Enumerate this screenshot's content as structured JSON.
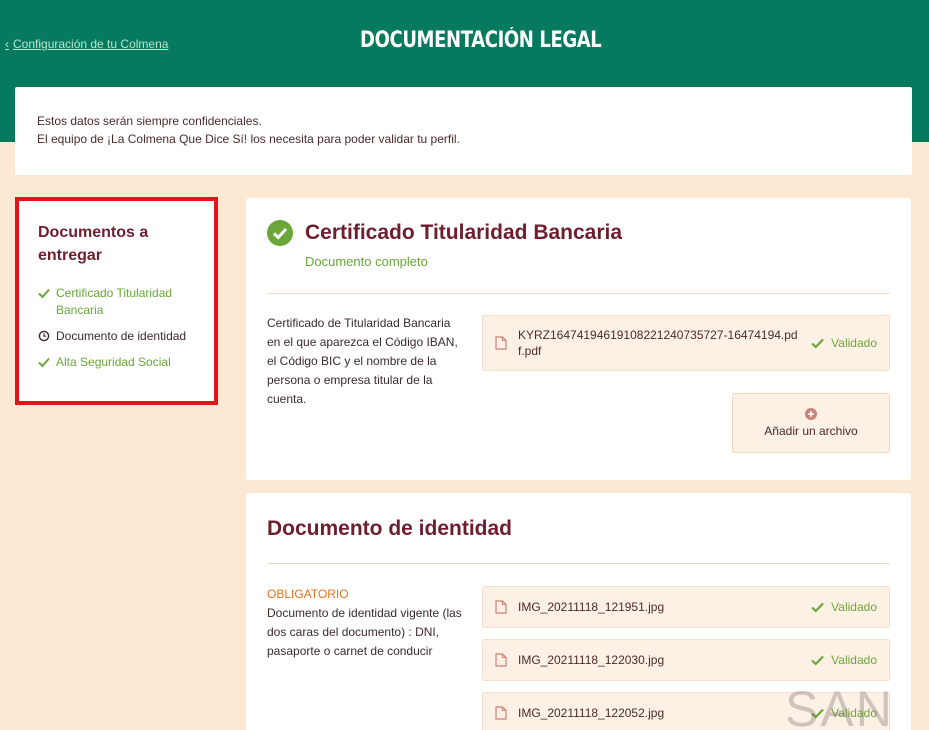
{
  "header": {
    "back_link": "Configuración de tu Colmena",
    "title": "DOCUMENTACIÓN LEGAL",
    "bg_color": "#067a5f"
  },
  "notice": {
    "line1": "Estos datos serán siempre confidenciales.",
    "line2": "El equipo de ¡La Colmena Que Dice Sí! los necesita para poder validar tu perfil."
  },
  "sidebar": {
    "title": "Documentos a entregar",
    "items": [
      {
        "label": "Certificado Titularidad Bancaria",
        "status": "done",
        "icon": "check-icon"
      },
      {
        "label": "Documento de identidad",
        "status": "pending",
        "icon": "clock-icon"
      },
      {
        "label": "Alta Seguridad Social",
        "status": "done",
        "icon": "check-icon"
      }
    ]
  },
  "card_bank": {
    "title": "Certificado Titularidad Bancaria",
    "subtitle": "Documento completo",
    "description": "Certificado de Titularidad Bancaria en el que aparezca el Código IBAN, el Código BIC y el nombre de la persona o empresa titular de la cuenta.",
    "files": [
      {
        "name": "KYRZ16474194619108221240735727-16474194.pdf.pdf",
        "status": "Validado"
      }
    ],
    "add_button": "Añadir un archivo"
  },
  "card_id": {
    "title": "Documento de identidad",
    "required": "OBLIGATORIO",
    "description": "Documento de identidad vigente (las dos caras del documento) : DNI, pasaporte o carnet de conducir",
    "files": [
      {
        "name": "IMG_20211118_121951.jpg",
        "status": "Validado"
      },
      {
        "name": "IMG_20211118_122030.jpg",
        "status": "Validado"
      },
      {
        "name": "IMG_20211118_122052.jpg",
        "status": "Validado"
      }
    ]
  },
  "watermark": "SAN",
  "colors": {
    "accent_green": "#6aa63a",
    "title_maroon": "#6d1f2e",
    "highlight_red": "#e6121b",
    "required_orange": "#e8701a"
  }
}
